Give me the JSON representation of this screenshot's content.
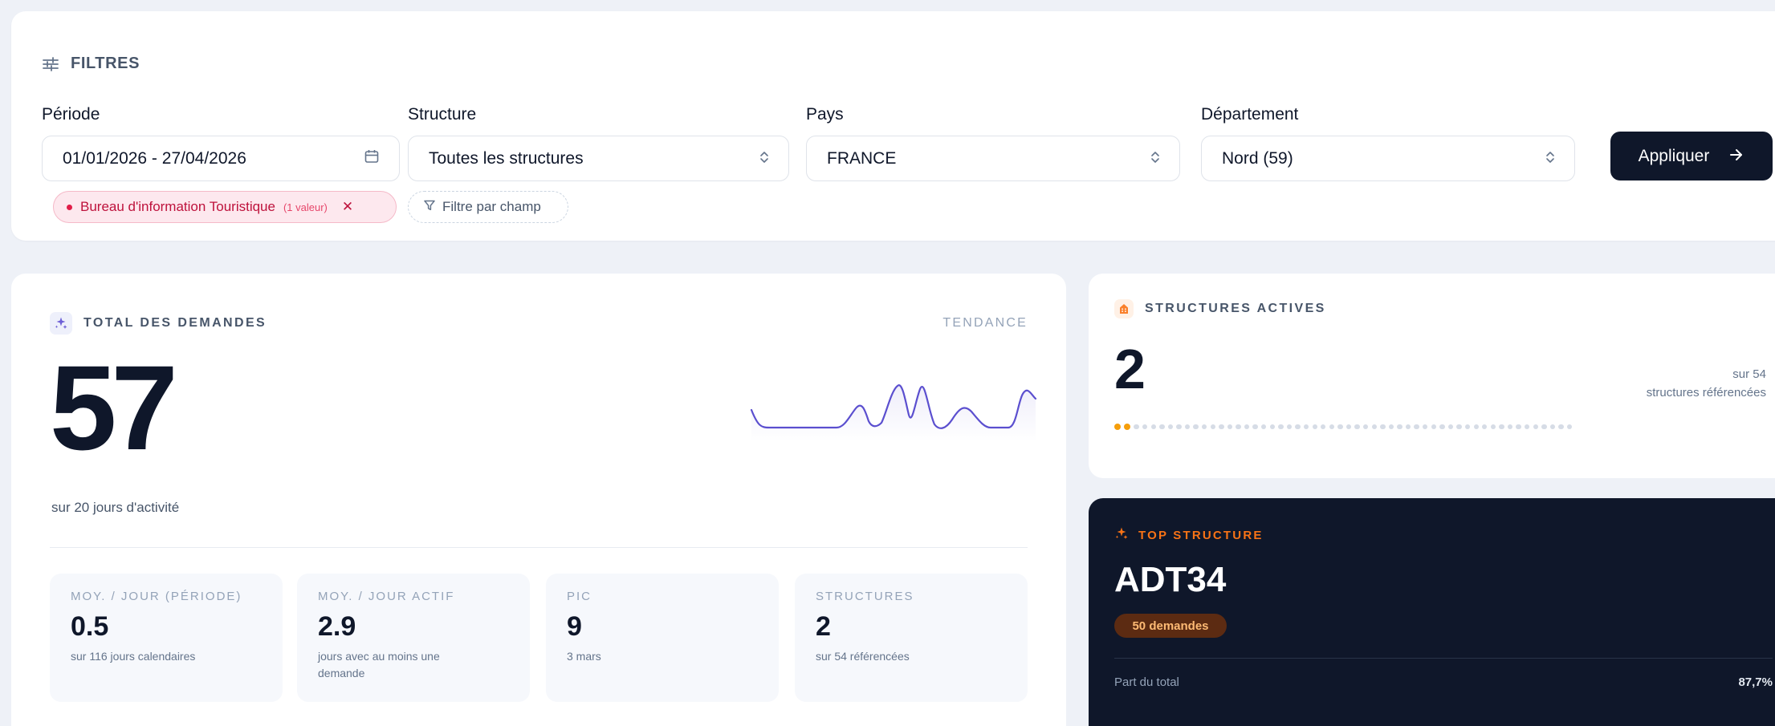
{
  "filters": {
    "title": "FILTRES",
    "periode": {
      "label": "Période",
      "value": "01/01/2026 - 27/04/2026"
    },
    "structure": {
      "label": "Structure",
      "value": "Toutes les structures"
    },
    "pays": {
      "label": "Pays",
      "value": "FRANCE"
    },
    "departement": {
      "label": "Département",
      "value": "Nord (59)"
    },
    "apply_label": "Appliquer",
    "active_chip": {
      "label": "Bureau d'information Touristique",
      "count": "(1 valeur)"
    },
    "add_filter_label": "Filtre par champ"
  },
  "total": {
    "title": "TOTAL DES DEMANDES",
    "trend_label": "TENDANCE",
    "value": "57",
    "note": "sur 20 jours d'activité",
    "sparkline_color": "#5b4fcf",
    "stats": [
      {
        "label": "MOY. / JOUR (PÉRIODE)",
        "value": "0.5",
        "sub": "sur 116 jours calendaires"
      },
      {
        "label": "MOY. / JOUR ACTIF",
        "value": "2.9",
        "sub": "jours avec au moins une demande"
      },
      {
        "label": "PIC",
        "value": "9",
        "sub": "3 mars"
      },
      {
        "label": "STRUCTURES",
        "value": "2",
        "sub": "sur 54 référencées"
      }
    ]
  },
  "structures": {
    "title": "STRUCTURES ACTIVES",
    "value": "2",
    "sub_line1": "sur 54",
    "sub_line2": "structures référencées",
    "active_count": 2,
    "total_count": 54,
    "accent": "#f59e0b"
  },
  "top": {
    "title": "TOP STRUCTURE",
    "name": "ADT34",
    "badge": "50 demandes",
    "share_label": "Part du total",
    "share_value": "87,7%",
    "accent": "#f97316"
  }
}
